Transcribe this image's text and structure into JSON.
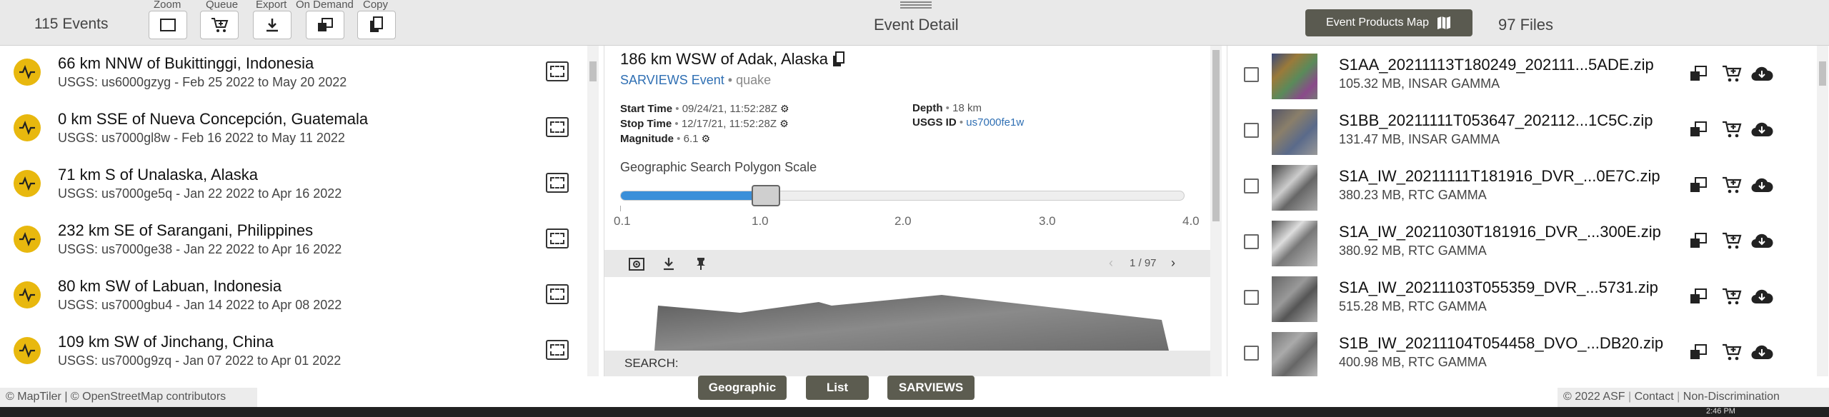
{
  "header": {
    "event_count": "115 Events",
    "center_title": "Event Detail",
    "products_map_button": "Event Products Map",
    "file_count": "97 Files",
    "toolbar": [
      {
        "label": "Zoom",
        "icon": "zoom-bounds-icon"
      },
      {
        "label": "Queue",
        "icon": "cart-add-icon"
      },
      {
        "label": "Export",
        "icon": "download-icon"
      },
      {
        "label": "On Demand",
        "icon": "on-demand-icon"
      },
      {
        "label": "Copy",
        "icon": "copy-icon"
      }
    ]
  },
  "events": [
    {
      "title": "66 km NNW of Bukittinggi, Indonesia",
      "subtitle": "USGS: us6000gzyg - Feb 25 2022 to May 20 2022"
    },
    {
      "title": "0 km SSE of Nueva Concepción, Guatemala",
      "subtitle": "USGS: us7000gl8w - Feb 16 2022 to May 11 2022"
    },
    {
      "title": "71 km S of Unalaska, Alaska",
      "subtitle": "USGS: us7000ge5q - Jan 22 2022 to Apr 16 2022"
    },
    {
      "title": "232 km SE of Sarangani, Philippines",
      "subtitle": "USGS: us7000ge38 - Jan 22 2022 to Apr 16 2022"
    },
    {
      "title": "80 km SW of Labuan, Indonesia",
      "subtitle": "USGS: us7000gbu4 - Jan 14 2022 to Apr 08 2022"
    },
    {
      "title": "109 km SW of Jinchang, China",
      "subtitle": "USGS: us7000g9zq - Jan 07 2022 to Apr 01 2022"
    }
  ],
  "detail": {
    "title": "186 km WSW of Adak, Alaska",
    "source_link": "SARVIEWS Event",
    "separator": "•",
    "event_type": "quake",
    "start_label": "Start Time",
    "start_value": "09/24/21, 11:52:28Z",
    "stop_label": "Stop Time",
    "stop_value": "12/17/21, 11:52:28Z",
    "magnitude_label": "Magnitude",
    "magnitude_value": "6.1",
    "depth_label": "Depth",
    "depth_value": "18 km",
    "usgs_label": "USGS ID",
    "usgs_value": "us7000fe1w",
    "polygon_scale_label": "Geographic Search Polygon Scale",
    "slider_value": 1.1,
    "slider_min": 0.1,
    "slider_max": 4.0,
    "ticks": [
      "0.1",
      "1.0",
      "2.0",
      "3.0",
      "4.0"
    ],
    "pager": "1 / 97"
  },
  "search_bar": {
    "label": "SEARCH:",
    "buttons": [
      "Geographic",
      "List",
      "SARVIEWS"
    ]
  },
  "files": [
    {
      "name": "S1AA_20211113T180249_202111...5ADE.zip",
      "meta": "105.32 MB, INSAR GAMMA"
    },
    {
      "name": "S1BB_20211111T053647_202112...1C5C.zip",
      "meta": "131.47 MB, INSAR GAMMA"
    },
    {
      "name": "S1A_IW_20211111T181916_DVR_...0E7C.zip",
      "meta": "380.23 MB, RTC GAMMA"
    },
    {
      "name": "S1A_IW_20211030T181916_DVR_...300E.zip",
      "meta": "380.92 MB, RTC GAMMA"
    },
    {
      "name": "S1A_IW_20211103T055359_DVR_...5731.zip",
      "meta": "515.28 MB, RTC GAMMA"
    },
    {
      "name": "S1B_IW_20211104T054458_DVO_...DB20.zip",
      "meta": "400.98 MB, RTC GAMMA"
    }
  ],
  "footer": {
    "map_credits": "© MapTiler | © OpenStreetMap contributors",
    "copyright": "© 2022 ASF",
    "contact": "Contact",
    "nondiscrimination": "Non-Discrimination",
    "clock": "2:46 PM"
  },
  "colors": {
    "accent": "#2f6fb3",
    "event_icon": "#e8b80e",
    "slider": "#3a8fd9",
    "pill": "#5c5c50"
  }
}
